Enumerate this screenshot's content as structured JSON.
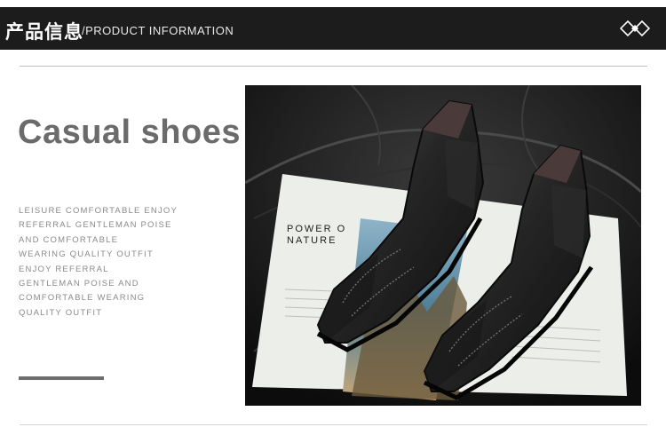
{
  "header": {
    "title_cn": "产品信息",
    "title_en": "/PRODUCT INFORMATION",
    "logo_icon": "diamond-logo-icon"
  },
  "main": {
    "title": "Casual shoes",
    "description_lines": [
      "LEISURE COMFORTABLE ENJOY",
      "REFERRAL GENTLEMAN POISE",
      "AND COMFORTABLE",
      "WEARING QUALITY OUTFIT",
      "ENJOY REFERRAL",
      "GENTLEMAN POISE AND",
      "COMFORTABLE WEARING",
      "QUALITY OUTFIT"
    ]
  },
  "photo": {
    "magazine_headline_1": "POWER O",
    "magazine_headline_2": "NATURE"
  },
  "colors": {
    "header_bg": "#1c1c1c",
    "title": "#6b6b6b",
    "body_text": "#8a8a8a",
    "accent": "#6e6e6e"
  }
}
